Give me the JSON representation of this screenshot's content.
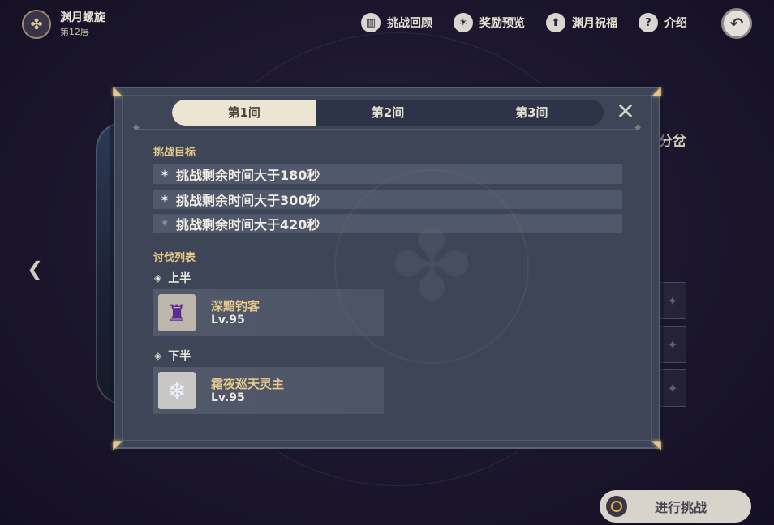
{
  "header": {
    "floor_name": "渊月螺旋",
    "floor_sub": "第12层",
    "menu": [
      {
        "label": "挑战回顾",
        "icon": "book-icon"
      },
      {
        "label": "奖励预览",
        "icon": "star-icon"
      },
      {
        "label": "渊月祝福",
        "icon": "up-arrow-icon"
      },
      {
        "label": "介绍",
        "icon": "help-icon"
      }
    ]
  },
  "background": {
    "tab_label": "分岔"
  },
  "modal": {
    "tabs": [
      "第1间",
      "第2间",
      "第3间"
    ],
    "active_tab": 0,
    "objectives_title": "挑战目标",
    "objectives": [
      {
        "text": "挑战剩余时间大于180秒",
        "achieved": true
      },
      {
        "text": "挑战剩余时间大于300秒",
        "achieved": true
      },
      {
        "text": "挑战剩余时间大于420秒",
        "achieved": false
      }
    ],
    "enemy_list_title": "讨伐列表",
    "halves": [
      {
        "label": "上半",
        "enemy": {
          "name": "深黯钓客",
          "level": "Lv.95"
        }
      },
      {
        "label": "下半",
        "enemy": {
          "name": "霜夜巡天灵主",
          "level": "Lv.95"
        }
      }
    ]
  },
  "start_button": {
    "label": "进行挑战"
  }
}
